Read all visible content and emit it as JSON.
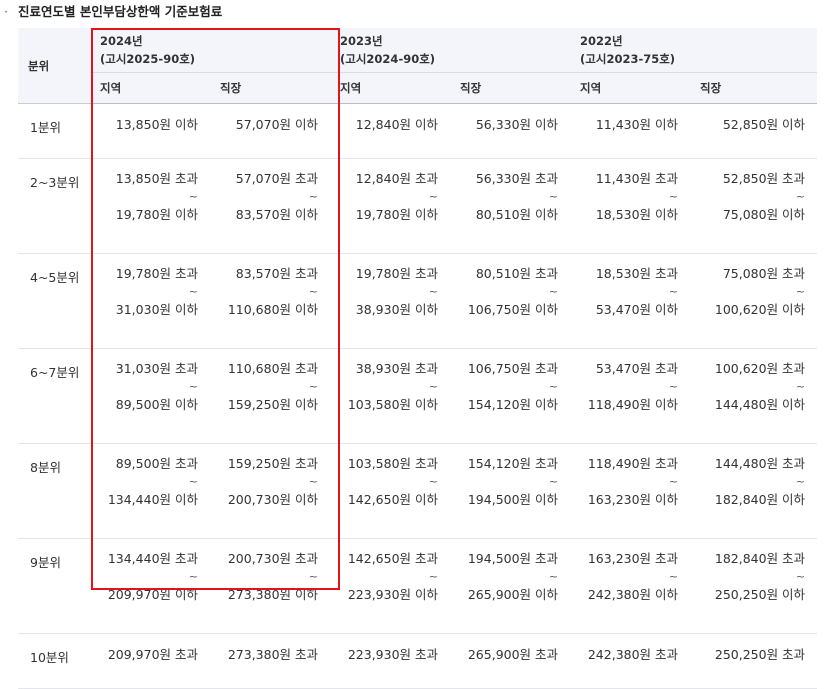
{
  "title": "진료연도별 본인부담상한액 기준보험료",
  "highlight_color": "#e0141a",
  "header": {
    "rowhead": "분위",
    "years": [
      {
        "year": "2024년",
        "notice": "(고시2025-90호)"
      },
      {
        "year": "2023년",
        "notice": "(고시2024-90호)"
      },
      {
        "year": "2022년",
        "notice": "(고시2023-75호)"
      }
    ],
    "sub": [
      "지역",
      "직장",
      "지역",
      "직장",
      "지역",
      "직장"
    ]
  },
  "rows": [
    {
      "label": "1분위",
      "cells": [
        {
          "top": "13,850원 이하"
        },
        {
          "top": "57,070원 이하"
        },
        {
          "top": "12,840원 이하"
        },
        {
          "top": "56,330원 이하"
        },
        {
          "top": "11,430원 이하"
        },
        {
          "top": "52,850원 이하"
        }
      ]
    },
    {
      "label": "2~3분위",
      "cells": [
        {
          "top": "13,850원 초과",
          "tilde": "~",
          "bottom": "19,780원 이하"
        },
        {
          "top": "57,070원 초과",
          "tilde": "~",
          "bottom": "83,570원 이하"
        },
        {
          "top": "12,840원 초과",
          "tilde": "~",
          "bottom": "19,780원 이하"
        },
        {
          "top": "56,330원 초과",
          "tilde": "~",
          "bottom": "80,510원 이하"
        },
        {
          "top": "11,430원 초과",
          "tilde": "~",
          "bottom": "18,530원 이하"
        },
        {
          "top": "52,850원 초과",
          "tilde": "~",
          "bottom": "75,080원 이하"
        }
      ]
    },
    {
      "label": "4~5분위",
      "cells": [
        {
          "top": "19,780원 초과",
          "tilde": "~",
          "bottom": "31,030원 이하"
        },
        {
          "top": "83,570원 초과",
          "tilde": "~",
          "bottom": "110,680원 이하"
        },
        {
          "top": "19,780원 초과",
          "tilde": "~",
          "bottom": "38,930원 이하"
        },
        {
          "top": "80,510원 초과",
          "tilde": "~",
          "bottom": "106,750원 이하"
        },
        {
          "top": "18,530원 초과",
          "tilde": "~",
          "bottom": "53,470원 이하"
        },
        {
          "top": "75,080원 초과",
          "tilde": "~",
          "bottom": "100,620원 이하"
        }
      ]
    },
    {
      "label": "6~7분위",
      "cells": [
        {
          "top": "31,030원 초과",
          "tilde": "~",
          "bottom": "89,500원 이하"
        },
        {
          "top": "110,680원 초과",
          "tilde": "~",
          "bottom": "159,250원 이하"
        },
        {
          "top": "38,930원 초과",
          "tilde": "~",
          "bottom": "103,580원 이하"
        },
        {
          "top": "106,750원 초과",
          "tilde": "~",
          "bottom": "154,120원 이하"
        },
        {
          "top": "53,470원 초과",
          "tilde": "~",
          "bottom": "118,490원 이하"
        },
        {
          "top": "100,620원 초과",
          "tilde": "~",
          "bottom": "144,480원 이하"
        }
      ]
    },
    {
      "label": "8분위",
      "cells": [
        {
          "top": "89,500원 초과",
          "tilde": "~",
          "bottom": "134,440원 이하"
        },
        {
          "top": "159,250원 초과",
          "tilde": "~",
          "bottom": "200,730원 이하"
        },
        {
          "top": "103,580원 초과",
          "tilde": "~",
          "bottom": "142,650원 이하"
        },
        {
          "top": "154,120원 초과",
          "tilde": "~",
          "bottom": "194,500원 이하"
        },
        {
          "top": "118,490원 초과",
          "tilde": "~",
          "bottom": "163,230원 이하"
        },
        {
          "top": "144,480원 초과",
          "tilde": "~",
          "bottom": "182,840원 이하"
        }
      ]
    },
    {
      "label": "9분위",
      "cells": [
        {
          "top": "134,440원 초과",
          "tilde": "~",
          "bottom": "209,970원 이하"
        },
        {
          "top": "200,730원 초과",
          "tilde": "~",
          "bottom": "273,380원 이하"
        },
        {
          "top": "142,650원 초과",
          "tilde": "~",
          "bottom": "223,930원 이하"
        },
        {
          "top": "194,500원 초과",
          "tilde": "~",
          "bottom": "265,900원 이하"
        },
        {
          "top": "163,230원 초과",
          "tilde": "~",
          "bottom": "242,380원 이하"
        },
        {
          "top": "182,840원 초과",
          "tilde": "~",
          "bottom": "250,250원 이하"
        }
      ]
    },
    {
      "label": "10분위",
      "cells": [
        {
          "top": "209,970원 초과"
        },
        {
          "top": "273,380원 초과"
        },
        {
          "top": "223,930원 초과"
        },
        {
          "top": "265,900원 초과"
        },
        {
          "top": "242,380원 초과"
        },
        {
          "top": "250,250원 초과"
        }
      ]
    }
  ]
}
